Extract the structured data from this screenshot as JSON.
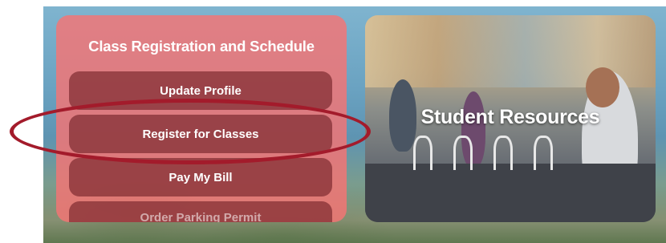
{
  "left_card": {
    "title": "Class Registration and Schedule",
    "buttons": [
      {
        "label": "Update Profile"
      },
      {
        "label": "Register for Classes"
      },
      {
        "label": "Pay My Bill"
      },
      {
        "label": "Order Parking Permit"
      }
    ]
  },
  "right_card": {
    "title": "Student Resources"
  },
  "colors": {
    "card_bg": "#f67474",
    "button_bg": "#802c32",
    "highlight": "#a31b2b"
  }
}
